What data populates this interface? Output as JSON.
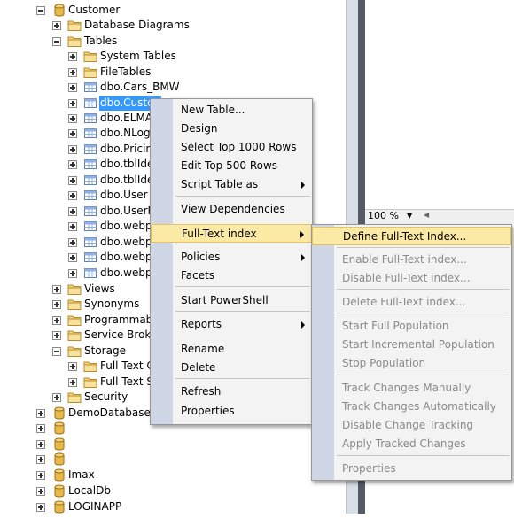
{
  "tree": {
    "items": [
      {
        "label": "Customer",
        "icon": "database-icon",
        "expander": "minus"
      },
      {
        "label": "Database Diagrams",
        "icon": "folder-icon",
        "expander": "plus"
      },
      {
        "label": "Tables",
        "icon": "folder-icon",
        "expander": "minus"
      },
      {
        "label": "System Tables",
        "icon": "folder-icon",
        "expander": "plus"
      },
      {
        "label": "FileTables",
        "icon": "folder-icon",
        "expander": "plus"
      },
      {
        "label": "dbo.Cars_BMW",
        "icon": "table-icon",
        "expander": "plus"
      },
      {
        "label": "dbo.Custon",
        "icon": "table-icon",
        "expander": "plus",
        "selected": true
      },
      {
        "label": "dbo.ELMAH",
        "icon": "table-icon",
        "expander": "plus"
      },
      {
        "label": "dbo.NLog_",
        "icon": "table-icon",
        "expander": "plus"
      },
      {
        "label": "dbo.Pricing",
        "icon": "table-icon",
        "expander": "plus"
      },
      {
        "label": "dbo.tblIden",
        "icon": "table-icon",
        "expander": "plus"
      },
      {
        "label": "dbo.tblIden",
        "icon": "table-icon",
        "expander": "plus"
      },
      {
        "label": "dbo.User",
        "icon": "table-icon",
        "expander": "plus"
      },
      {
        "label": "dbo.UserPr",
        "icon": "table-icon",
        "expander": "plus"
      },
      {
        "label": "dbo.webpa",
        "icon": "table-icon",
        "expander": "plus"
      },
      {
        "label": "dbo.webpa",
        "icon": "table-icon",
        "expander": "plus"
      },
      {
        "label": "dbo.webpa",
        "icon": "table-icon",
        "expander": "plus"
      },
      {
        "label": "dbo.webpa",
        "icon": "table-icon",
        "expander": "plus"
      },
      {
        "label": "Views",
        "icon": "folder-icon",
        "expander": "plus"
      },
      {
        "label": "Synonyms",
        "icon": "folder-icon",
        "expander": "plus"
      },
      {
        "label": "Programmabil",
        "icon": "folder-icon",
        "expander": "plus"
      },
      {
        "label": "Service Broker",
        "icon": "folder-icon",
        "expander": "plus"
      },
      {
        "label": "Storage",
        "icon": "folder-icon",
        "expander": "minus"
      },
      {
        "label": "Full Text Ca",
        "icon": "folder-icon",
        "expander": "plus"
      },
      {
        "label": "Full Text St",
        "icon": "folder-icon",
        "expander": "plus"
      },
      {
        "label": "Security",
        "icon": "folder-icon",
        "expander": "plus"
      },
      {
        "label": "DemoDatabase",
        "icon": "database-icon",
        "expander": "plus"
      },
      {
        "label": "",
        "icon": "database-icon",
        "expander": "plus"
      },
      {
        "label": "",
        "icon": "database-icon",
        "expander": "plus"
      },
      {
        "label": "",
        "icon": "database-icon",
        "expander": "plus"
      },
      {
        "label": "Imax",
        "icon": "database-icon",
        "expander": "plus"
      },
      {
        "label": "LocalDb",
        "icon": "database-icon",
        "expander": "plus"
      },
      {
        "label": "LOGINAPP",
        "icon": "database-icon",
        "expander": "plus"
      }
    ]
  },
  "editor": {
    "zoom": "100 %"
  },
  "context_menu": {
    "items": [
      {
        "label": "New Table..."
      },
      {
        "label": "Design"
      },
      {
        "label": "Select Top 1000 Rows"
      },
      {
        "label": "Edit Top 500 Rows"
      },
      {
        "label": "Script Table as",
        "submenu": true
      },
      {
        "label": "View Dependencies"
      },
      {
        "label": "Full-Text index",
        "submenu": true,
        "highlighted": true
      },
      {
        "label": "Policies",
        "submenu": true
      },
      {
        "label": "Facets"
      },
      {
        "label": "Start PowerShell"
      },
      {
        "label": "Reports",
        "submenu": true
      },
      {
        "label": "Rename"
      },
      {
        "label": "Delete"
      },
      {
        "label": "Refresh"
      },
      {
        "label": "Properties"
      }
    ]
  },
  "fulltext_submenu": {
    "items": [
      {
        "label": "Define Full-Text Index...",
        "enabled": true,
        "highlighted": true
      },
      {
        "label": "Enable Full-Text index...",
        "enabled": false
      },
      {
        "label": "Disable Full-Text index...",
        "enabled": false
      },
      {
        "label": "Delete Full-Text index...",
        "enabled": false
      },
      {
        "label": "Start Full Population",
        "enabled": false
      },
      {
        "label": "Start Incremental Population",
        "enabled": false
      },
      {
        "label": "Stop Population",
        "enabled": false
      },
      {
        "label": "Track Changes Manually",
        "enabled": false
      },
      {
        "label": "Track Changes Automatically",
        "enabled": false
      },
      {
        "label": "Disable Change Tracking",
        "enabled": false
      },
      {
        "label": "Apply Tracked Changes",
        "enabled": false
      },
      {
        "label": "Properties",
        "enabled": false
      }
    ]
  },
  "colors": {
    "selection": "#3399ff",
    "menu_highlight": "#fbe9a6",
    "menu_gutter": "#cfd6e5",
    "disabled_text": "#8a8a8a"
  }
}
